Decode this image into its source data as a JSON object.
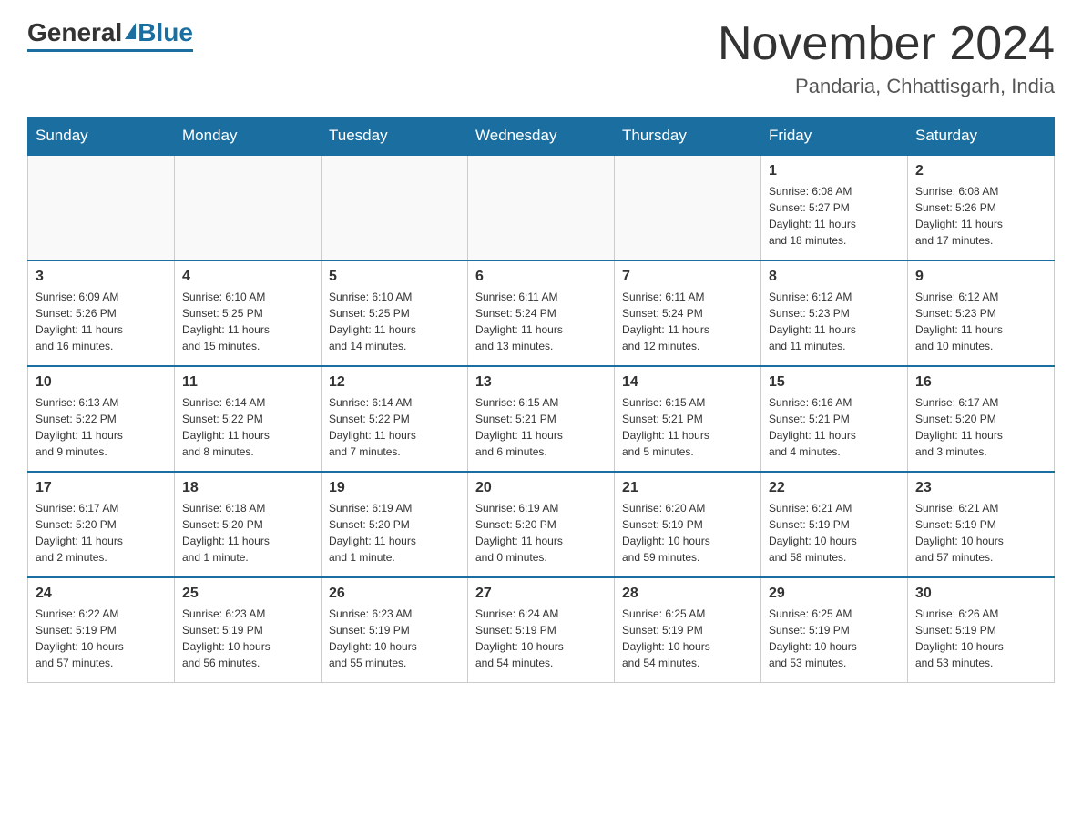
{
  "header": {
    "logo_general": "General",
    "logo_blue": "Blue",
    "month_title": "November 2024",
    "location": "Pandaria, Chhattisgarh, India"
  },
  "weekdays": [
    "Sunday",
    "Monday",
    "Tuesday",
    "Wednesday",
    "Thursday",
    "Friday",
    "Saturday"
  ],
  "weeks": [
    [
      {
        "day": "",
        "info": ""
      },
      {
        "day": "",
        "info": ""
      },
      {
        "day": "",
        "info": ""
      },
      {
        "day": "",
        "info": ""
      },
      {
        "day": "",
        "info": ""
      },
      {
        "day": "1",
        "info": "Sunrise: 6:08 AM\nSunset: 5:27 PM\nDaylight: 11 hours\nand 18 minutes."
      },
      {
        "day": "2",
        "info": "Sunrise: 6:08 AM\nSunset: 5:26 PM\nDaylight: 11 hours\nand 17 minutes."
      }
    ],
    [
      {
        "day": "3",
        "info": "Sunrise: 6:09 AM\nSunset: 5:26 PM\nDaylight: 11 hours\nand 16 minutes."
      },
      {
        "day": "4",
        "info": "Sunrise: 6:10 AM\nSunset: 5:25 PM\nDaylight: 11 hours\nand 15 minutes."
      },
      {
        "day": "5",
        "info": "Sunrise: 6:10 AM\nSunset: 5:25 PM\nDaylight: 11 hours\nand 14 minutes."
      },
      {
        "day": "6",
        "info": "Sunrise: 6:11 AM\nSunset: 5:24 PM\nDaylight: 11 hours\nand 13 minutes."
      },
      {
        "day": "7",
        "info": "Sunrise: 6:11 AM\nSunset: 5:24 PM\nDaylight: 11 hours\nand 12 minutes."
      },
      {
        "day": "8",
        "info": "Sunrise: 6:12 AM\nSunset: 5:23 PM\nDaylight: 11 hours\nand 11 minutes."
      },
      {
        "day": "9",
        "info": "Sunrise: 6:12 AM\nSunset: 5:23 PM\nDaylight: 11 hours\nand 10 minutes."
      }
    ],
    [
      {
        "day": "10",
        "info": "Sunrise: 6:13 AM\nSunset: 5:22 PM\nDaylight: 11 hours\nand 9 minutes."
      },
      {
        "day": "11",
        "info": "Sunrise: 6:14 AM\nSunset: 5:22 PM\nDaylight: 11 hours\nand 8 minutes."
      },
      {
        "day": "12",
        "info": "Sunrise: 6:14 AM\nSunset: 5:22 PM\nDaylight: 11 hours\nand 7 minutes."
      },
      {
        "day": "13",
        "info": "Sunrise: 6:15 AM\nSunset: 5:21 PM\nDaylight: 11 hours\nand 6 minutes."
      },
      {
        "day": "14",
        "info": "Sunrise: 6:15 AM\nSunset: 5:21 PM\nDaylight: 11 hours\nand 5 minutes."
      },
      {
        "day": "15",
        "info": "Sunrise: 6:16 AM\nSunset: 5:21 PM\nDaylight: 11 hours\nand 4 minutes."
      },
      {
        "day": "16",
        "info": "Sunrise: 6:17 AM\nSunset: 5:20 PM\nDaylight: 11 hours\nand 3 minutes."
      }
    ],
    [
      {
        "day": "17",
        "info": "Sunrise: 6:17 AM\nSunset: 5:20 PM\nDaylight: 11 hours\nand 2 minutes."
      },
      {
        "day": "18",
        "info": "Sunrise: 6:18 AM\nSunset: 5:20 PM\nDaylight: 11 hours\nand 1 minute."
      },
      {
        "day": "19",
        "info": "Sunrise: 6:19 AM\nSunset: 5:20 PM\nDaylight: 11 hours\nand 1 minute."
      },
      {
        "day": "20",
        "info": "Sunrise: 6:19 AM\nSunset: 5:20 PM\nDaylight: 11 hours\nand 0 minutes."
      },
      {
        "day": "21",
        "info": "Sunrise: 6:20 AM\nSunset: 5:19 PM\nDaylight: 10 hours\nand 59 minutes."
      },
      {
        "day": "22",
        "info": "Sunrise: 6:21 AM\nSunset: 5:19 PM\nDaylight: 10 hours\nand 58 minutes."
      },
      {
        "day": "23",
        "info": "Sunrise: 6:21 AM\nSunset: 5:19 PM\nDaylight: 10 hours\nand 57 minutes."
      }
    ],
    [
      {
        "day": "24",
        "info": "Sunrise: 6:22 AM\nSunset: 5:19 PM\nDaylight: 10 hours\nand 57 minutes."
      },
      {
        "day": "25",
        "info": "Sunrise: 6:23 AM\nSunset: 5:19 PM\nDaylight: 10 hours\nand 56 minutes."
      },
      {
        "day": "26",
        "info": "Sunrise: 6:23 AM\nSunset: 5:19 PM\nDaylight: 10 hours\nand 55 minutes."
      },
      {
        "day": "27",
        "info": "Sunrise: 6:24 AM\nSunset: 5:19 PM\nDaylight: 10 hours\nand 54 minutes."
      },
      {
        "day": "28",
        "info": "Sunrise: 6:25 AM\nSunset: 5:19 PM\nDaylight: 10 hours\nand 54 minutes."
      },
      {
        "day": "29",
        "info": "Sunrise: 6:25 AM\nSunset: 5:19 PM\nDaylight: 10 hours\nand 53 minutes."
      },
      {
        "day": "30",
        "info": "Sunrise: 6:26 AM\nSunset: 5:19 PM\nDaylight: 10 hours\nand 53 minutes."
      }
    ]
  ]
}
